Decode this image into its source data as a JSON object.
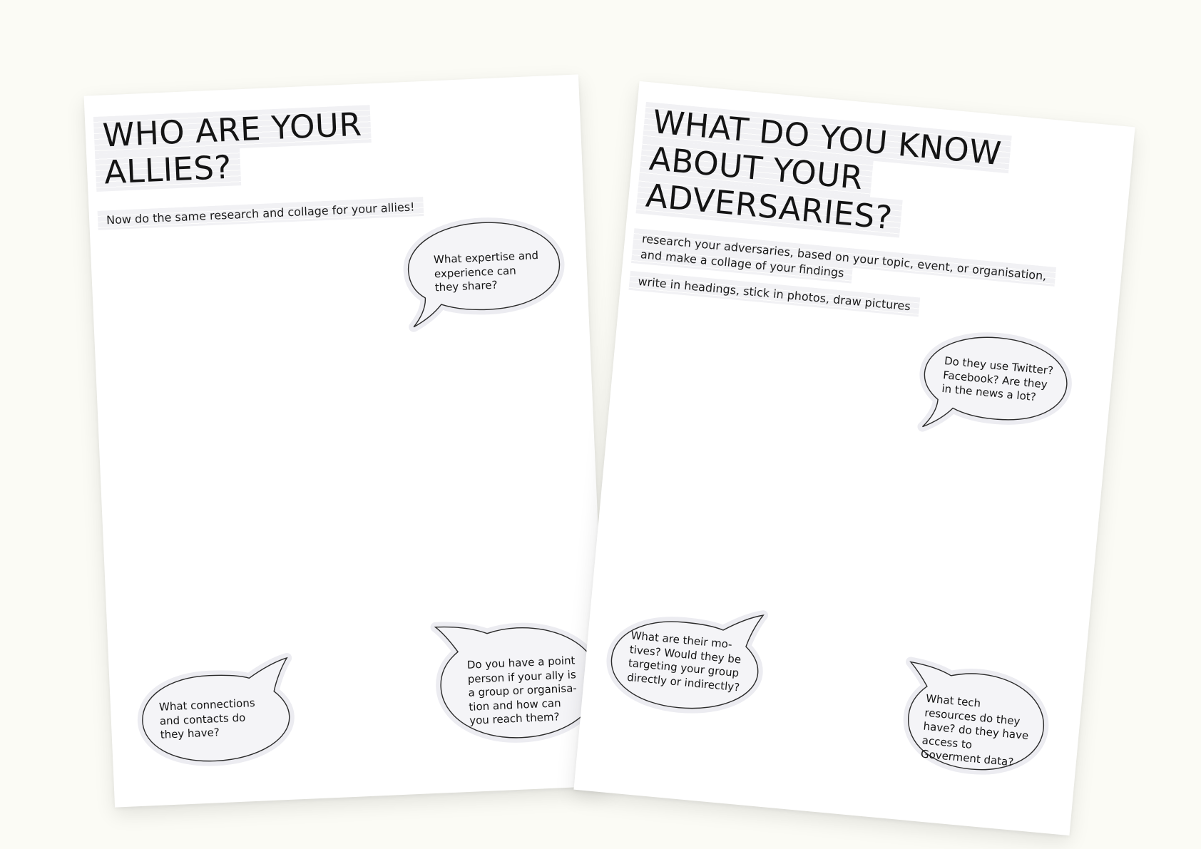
{
  "allies_sheet": {
    "title_line_1": "WHO ARE YOUR",
    "title_line_2": "ALLIES?",
    "subtitle": "Now do the same research and collage for your allies!",
    "bubbles": {
      "expertise": "What expertise and experience can they share?",
      "connections": "What connections and contacts do they have?",
      "point_person": "Do you have a point person if your ally is a group or organisa- tion and how can you reach them?"
    }
  },
  "adversaries_sheet": {
    "title_line_1": "WHAT DO YOU KNOW",
    "title_line_2": "ABOUT YOUR",
    "title_line_3": "ADVERSARIES?",
    "instruction_line_1": "research your adversaries, based on your topic, event, or organisation,",
    "instruction_line_2": "and make a collage of your findings",
    "instruction_line_3": "write in headings, stick in photos, draw pictures",
    "bubbles": {
      "social_media": "Do they use Twitter? Facebook? Are they in the news a lot?",
      "motives": "What are their mo- tives? Would they be targeting your group directly or indirectly?",
      "tech_resources": "What tech resources do they have? do they have access to Goverment data?"
    }
  },
  "colors": {
    "background": "#fbfbf5",
    "sheet": "#ffffff",
    "strip": "#f1f1f4",
    "ink": "#141414"
  }
}
